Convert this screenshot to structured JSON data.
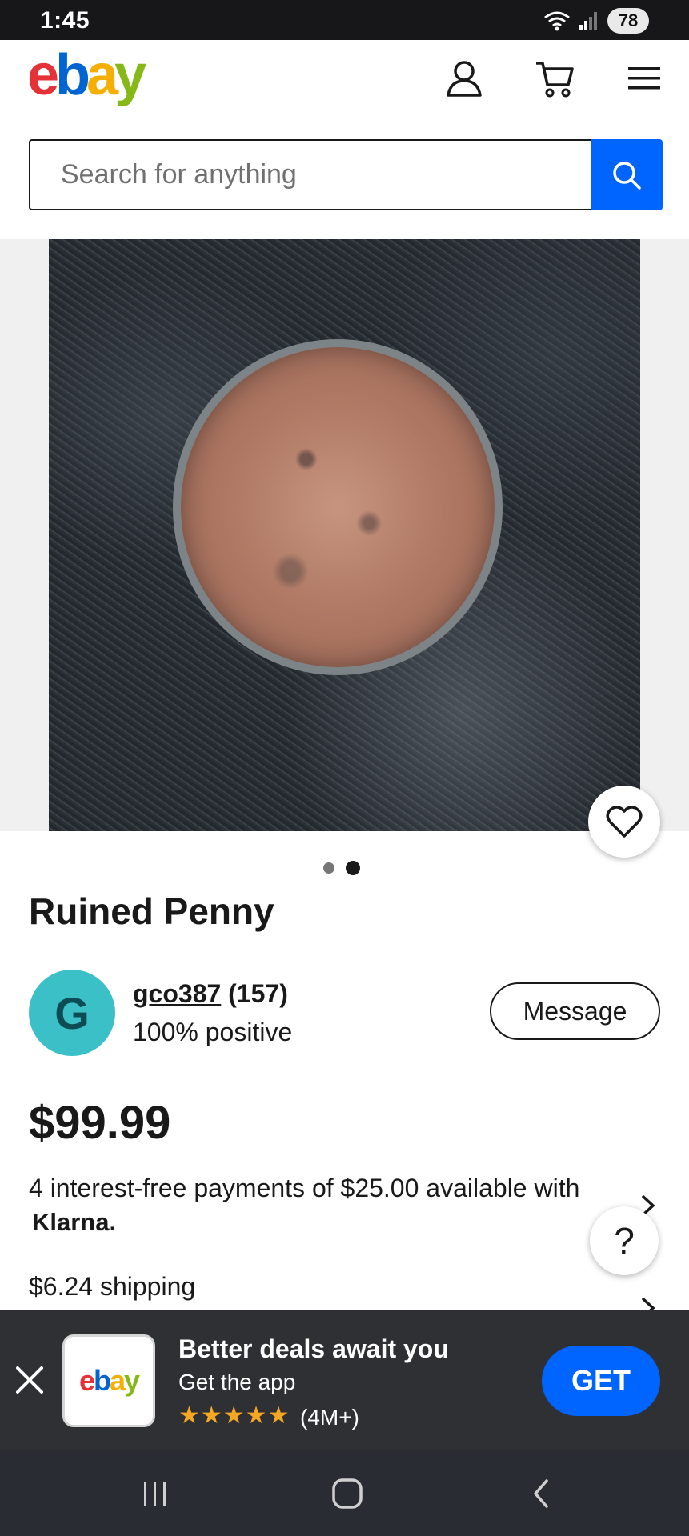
{
  "status_bar": {
    "time": "1:45",
    "battery": "78",
    "wifi_icon": "wifi-icon",
    "signal_icon": "signal-icon"
  },
  "header": {
    "logo_letters": [
      "e",
      "b",
      "a",
      "y"
    ],
    "account_icon": "user-icon",
    "cart_icon": "cart-icon",
    "menu_icon": "menu-icon"
  },
  "search": {
    "placeholder": "Search for anything",
    "icon": "search-icon"
  },
  "gallery": {
    "image_count": 2,
    "active_index": 1,
    "favorite_icon": "heart-icon"
  },
  "listing": {
    "title": "Ruined Penny",
    "seller": {
      "avatar_letter": "G",
      "username": "gco387",
      "feedback_count": "(157)",
      "positive": "100% positive"
    },
    "message_label": "Message",
    "price": "$99.99",
    "installments": "4 interest-free payments of $25.00 available with",
    "installments_brand": "Klarna.",
    "shipping": "$6.24 shipping",
    "help_label": "?"
  },
  "app_banner": {
    "close_icon": "close-icon",
    "app_logo_letters": [
      "e",
      "b",
      "a",
      "y"
    ],
    "headline": "Better deals await you",
    "subtitle": "Get the app",
    "stars": "★★★★★",
    "rating_count": "(4M+)",
    "get_label": "GET"
  },
  "nav_bar": {
    "recents_icon": "recents-icon",
    "home_icon": "home-icon",
    "back_icon": "back-icon"
  },
  "colors": {
    "accent": "#0064ff",
    "logo_red": "#e53238",
    "logo_blue": "#0064d2",
    "logo_yellow": "#f5af02",
    "logo_green": "#86b817",
    "avatar": "#3cc0c8",
    "banner_bg": "#2f3033"
  }
}
